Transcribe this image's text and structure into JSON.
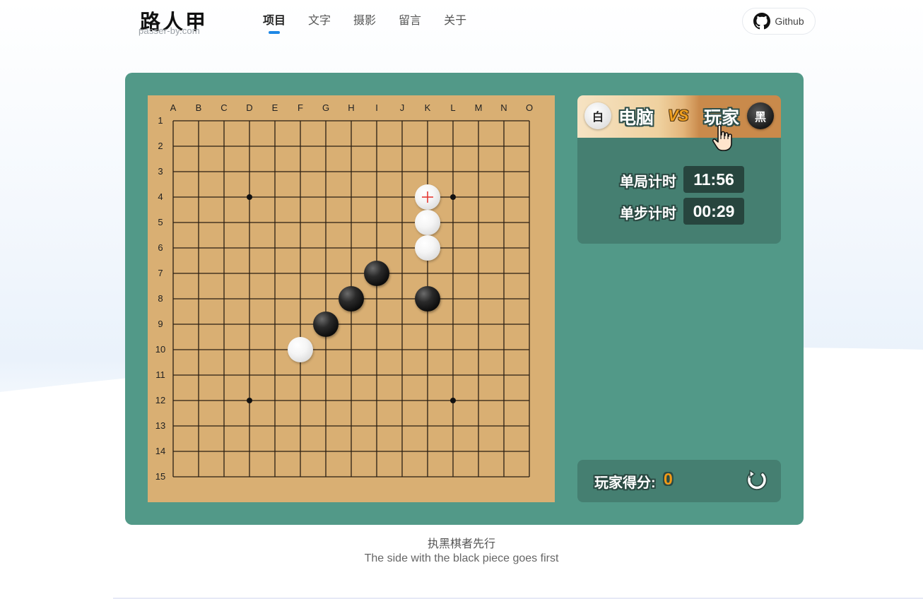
{
  "logo": {
    "cn": "路人甲",
    "en": "passer-by.com"
  },
  "nav": [
    {
      "label": "项目",
      "active": true
    },
    {
      "label": "文字",
      "active": false
    },
    {
      "label": "摄影",
      "active": false
    },
    {
      "label": "留言",
      "active": false
    },
    {
      "label": "关于",
      "active": false
    }
  ],
  "github": {
    "label": "Github",
    "icon": "github-icon"
  },
  "board": {
    "size": 15,
    "columns": [
      "A",
      "B",
      "C",
      "D",
      "E",
      "F",
      "G",
      "H",
      "I",
      "J",
      "K",
      "L",
      "M",
      "N",
      "O"
    ],
    "rows": [
      "1",
      "2",
      "3",
      "4",
      "5",
      "6",
      "7",
      "8",
      "9",
      "10",
      "11",
      "12",
      "13",
      "14",
      "15"
    ],
    "star_points": [
      [
        "D",
        "4"
      ],
      [
        "L",
        "4"
      ],
      [
        "D",
        "12"
      ],
      [
        "L",
        "12"
      ]
    ],
    "stones": [
      {
        "color": "white",
        "col": "K",
        "row": "4",
        "last_move": true
      },
      {
        "color": "white",
        "col": "K",
        "row": "5"
      },
      {
        "color": "white",
        "col": "K",
        "row": "6"
      },
      {
        "color": "black",
        "col": "I",
        "row": "7"
      },
      {
        "color": "black",
        "col": "H",
        "row": "8"
      },
      {
        "color": "black",
        "col": "K",
        "row": "8"
      },
      {
        "color": "black",
        "col": "G",
        "row": "9"
      },
      {
        "color": "white",
        "col": "F",
        "row": "10"
      }
    ],
    "colors": {
      "board": "#d9af73",
      "line": "#2a1e12",
      "panel": "#529988",
      "marker": "#e53935"
    }
  },
  "players": {
    "white_badge": "白",
    "computer": "电脑",
    "vs": "VS",
    "player": "玩家",
    "black_badge": "黑",
    "turn_icon": "pointing-hand-icon"
  },
  "timers": {
    "game_label": "单局计时",
    "game_value": "11:56",
    "step_label": "单步计时",
    "step_value": "00:29"
  },
  "score": {
    "label": "玩家得分:",
    "value": "0",
    "restart_icon": "restart-icon"
  },
  "caption": {
    "cn": "执黑棋者先行",
    "en": "The side with the black piece goes first"
  }
}
